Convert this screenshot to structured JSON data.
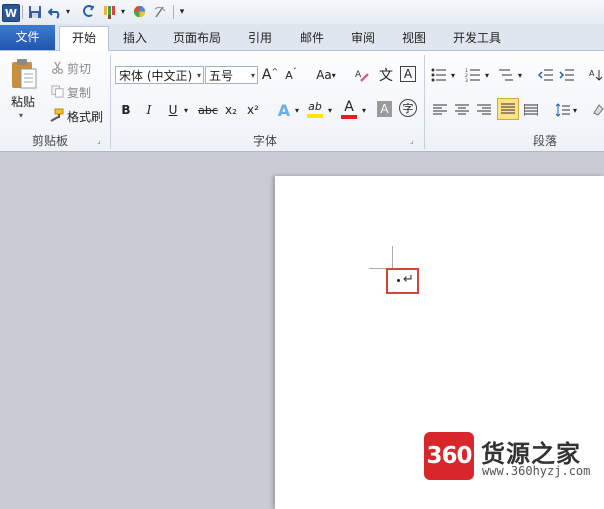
{
  "app": {
    "logo_letter": "W"
  },
  "tabs": {
    "file": "文件",
    "home": "开始",
    "insert": "插入",
    "page_layout": "页面布局",
    "references": "引用",
    "mailings": "邮件",
    "review": "审阅",
    "view": "视图",
    "developer": "开发工具"
  },
  "clipboard": {
    "paste": "粘贴",
    "cut": "剪切",
    "copy": "复制",
    "format_painter": "格式刷",
    "group_label": "剪贴板"
  },
  "font": {
    "font_name": "宋体 (中文正)",
    "font_size": "五号",
    "grow": "A",
    "shrink": "A",
    "change_case": "Aa",
    "phonetic": "文",
    "bold": "B",
    "italic": "I",
    "underline": "U",
    "strikethrough": "abc",
    "subscript": "x₂",
    "superscript": "x²",
    "text_effects": "A",
    "highlight": "ab",
    "font_color": "A",
    "char_shading": "A",
    "enclose": "字",
    "group_label": "字体"
  },
  "paragraph": {
    "group_label": "段落"
  },
  "document": {
    "paragraph_mark": "↵"
  },
  "watermark": {
    "logo_text": "360",
    "name": "货源之家",
    "url": "www.360hyzj.com"
  },
  "colors": {
    "accent": "#2b579a",
    "file_tab": "#2a62bc",
    "highlight_box": "#d7423a",
    "watermark_red": "#d8262d",
    "font_color_bar": "#e02020",
    "highlight_bar": "#ffe500"
  }
}
